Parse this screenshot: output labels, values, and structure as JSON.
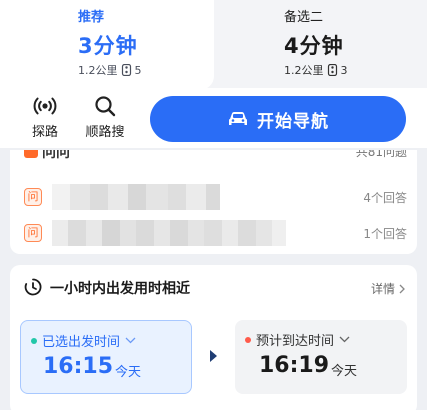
{
  "routes": [
    {
      "name": "推荐",
      "duration": "3分钟",
      "distance": "1.2公里",
      "lights": "5"
    },
    {
      "name": "备选二",
      "duration": "4分钟",
      "distance": "1.2公里",
      "lights": "3"
    }
  ],
  "actions": {
    "explore_label": "探路",
    "search_label": "顺路搜",
    "navigate_label": "开始导航"
  },
  "qa": {
    "title": "问问",
    "count_text": "共81问题",
    "items": [
      {
        "answers": "4个回答"
      },
      {
        "answers": "1个回答"
      }
    ],
    "question_icon_text": "问"
  },
  "time_card": {
    "title": "一小时内出发用时相近",
    "more_label": "详情",
    "departure": {
      "label": "已选出发时间",
      "time": "16:15",
      "day": "今天"
    },
    "arrival": {
      "label": "预计到达时间",
      "time": "16:19",
      "day": "今天"
    }
  },
  "colors": {
    "accent": "#2a6df6",
    "qa_orange": "#ff6a2a",
    "dep_dot": "#22c7a9",
    "arr_dot": "#ff5a4a"
  },
  "icons": [
    "traffic-light-icon",
    "broadcast-icon",
    "search-icon",
    "car-icon",
    "clock-icon",
    "chevron-down-icon",
    "chevron-right-icon"
  ]
}
